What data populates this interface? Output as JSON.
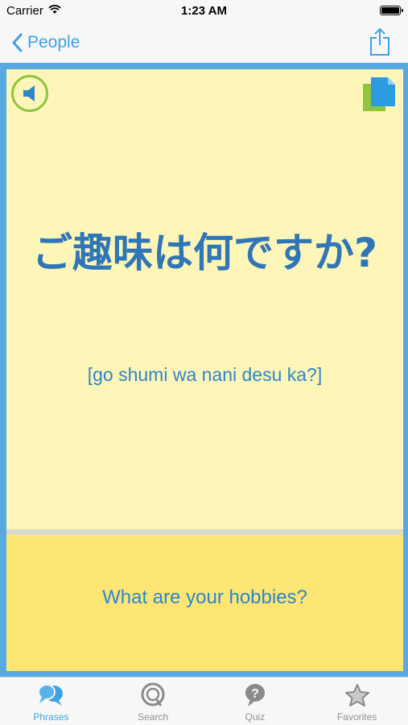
{
  "status_bar": {
    "carrier": "Carrier",
    "time": "1:23 AM"
  },
  "nav": {
    "back_label": "People",
    "back_icon": "chevron-left-icon",
    "share_icon": "share-icon"
  },
  "card": {
    "japanese": "ご趣味は何ですか?",
    "romaji": "[go shumi wa nani desu ka?]",
    "english": "What are your hobbies?",
    "speaker_icon": "speaker-icon",
    "copy_icon": "copy-icon"
  },
  "tabs": [
    {
      "label": "Phrases",
      "icon": "speech-bubbles-icon",
      "active": true
    },
    {
      "label": "Search",
      "icon": "search-icon",
      "active": false
    },
    {
      "label": "Quiz",
      "icon": "question-bubble-icon",
      "active": false
    },
    {
      "label": "Favorites",
      "icon": "star-icon",
      "active": false
    }
  ],
  "colors": {
    "accent": "#3fa2e3",
    "card_frame": "#58a9df",
    "card_top": "#fef5b8",
    "card_bottom": "#fee675",
    "speaker_ring": "#8dc63f",
    "text_blue": "#2f76b7"
  }
}
